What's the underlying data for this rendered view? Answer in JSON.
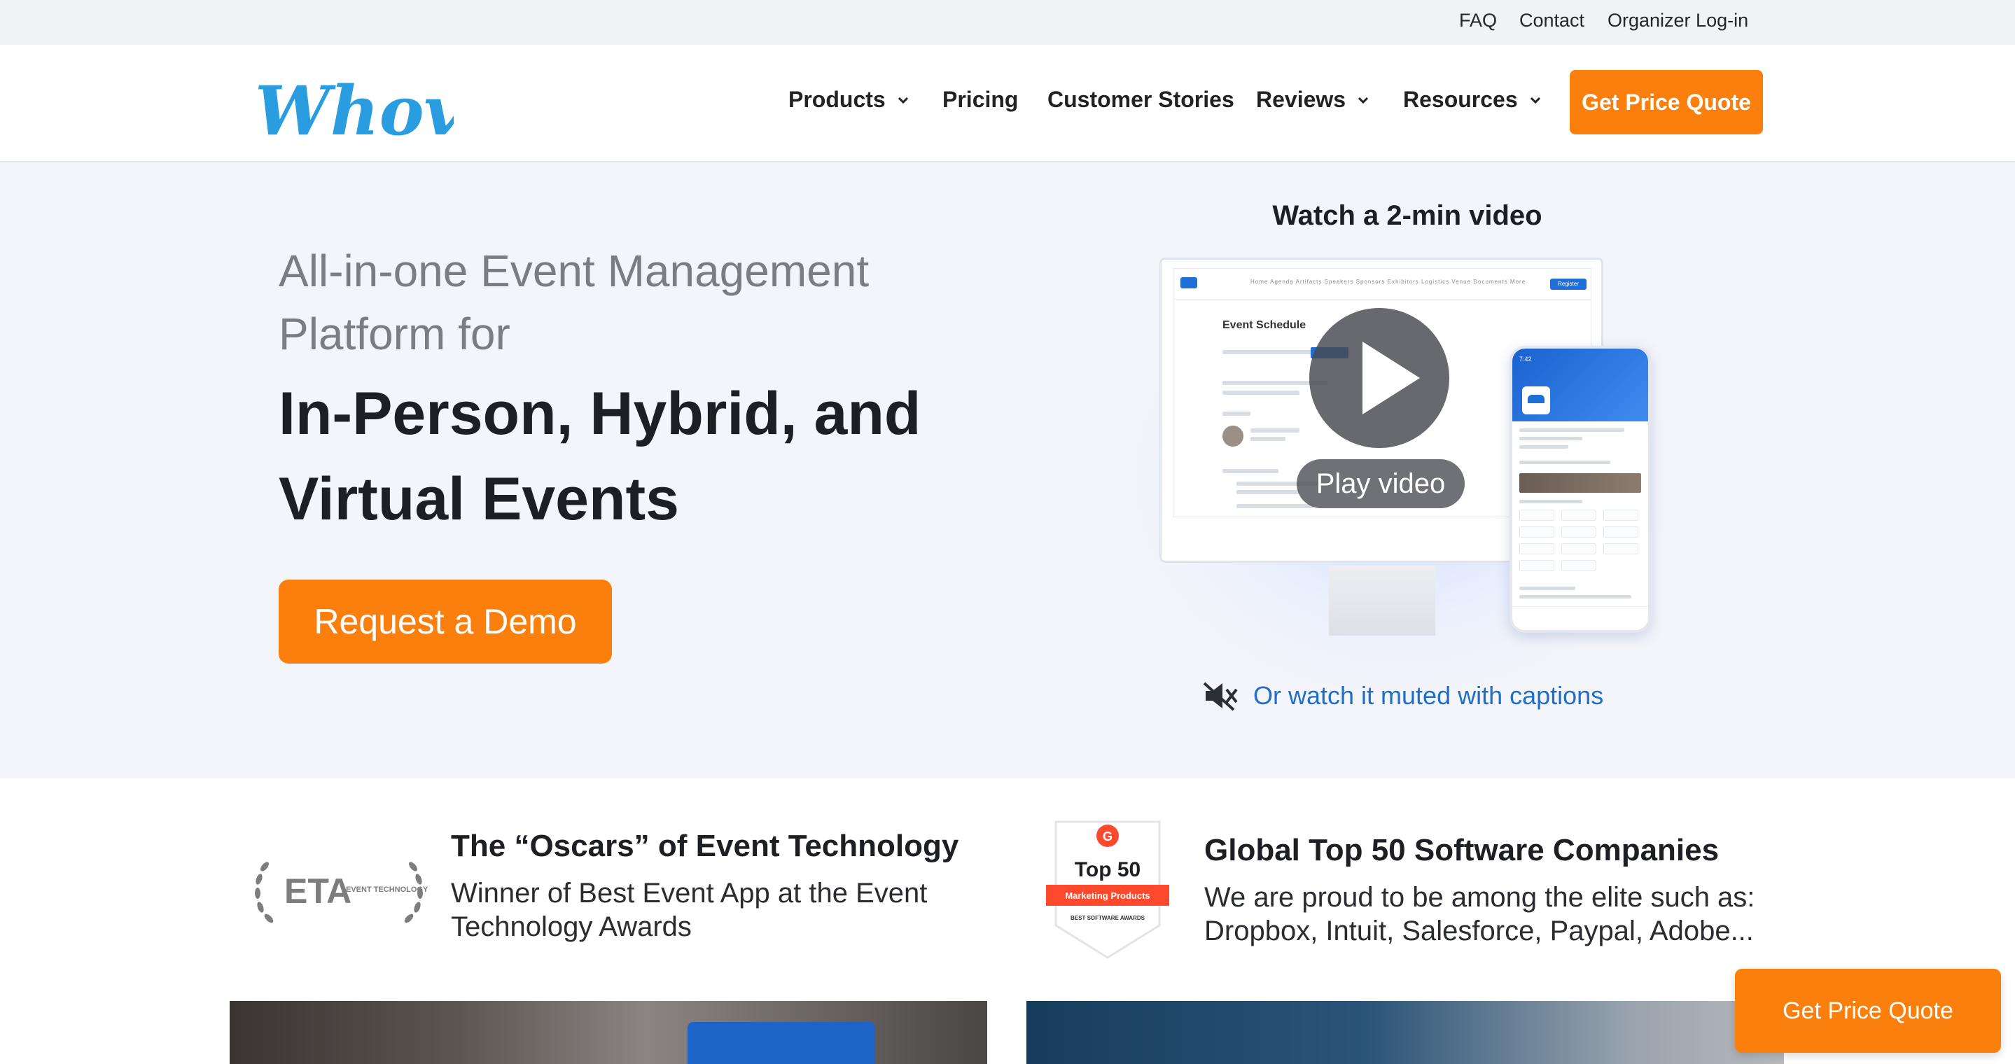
{
  "topbar": {
    "faq": "FAQ",
    "contact": "Contact",
    "organizer_login": "Organizer Log-in"
  },
  "nav": {
    "logo_text": "Whova",
    "products": "Products",
    "pricing": "Pricing",
    "customer_stories": "Customer Stories",
    "reviews": "Reviews",
    "resources": "Resources",
    "quote_button": "Get Price Quote"
  },
  "hero": {
    "subtitle": "All-in-one Event Management Platform for",
    "title": "In-Person, Hybrid, and Virtual Events",
    "demo_button": "Request a Demo",
    "video_title": "Watch a 2-min video",
    "play_label": "Play video",
    "muted_link": "Or watch it muted with captions",
    "preview": {
      "heading": "Event Schedule",
      "nav_items": "Home  Agenda  Artifacts  Speakers  Sponsors  Exhibitors  Logistics  Venue  Documents  More",
      "register": "Register",
      "phone_time": "7:42"
    }
  },
  "awards": {
    "eta": {
      "logo_text": "ETA",
      "logo_sub": "EVENT TECHNOLOGY AWARDS",
      "title": "The “Oscars” of Event Technology",
      "text": "Winner of Best Event App at the Event Technology Awards"
    },
    "g2": {
      "badge_title": "Top 50",
      "badge_ribbon": "Marketing Products",
      "badge_sub": "BEST SOFTWARE AWARDS",
      "title": "Global Top 50 Software Companies",
      "text": "We are proud to be among the elite such as: Dropbox, Intuit, Salesforce, Paypal, Adobe..."
    }
  },
  "floating_quote": "Get Price Quote",
  "colors": {
    "accent_orange": "#fb7f0c",
    "link_blue": "#1f6fc9",
    "logo_blue": "#2a9de0",
    "hero_bg": "#f3f5fa"
  }
}
